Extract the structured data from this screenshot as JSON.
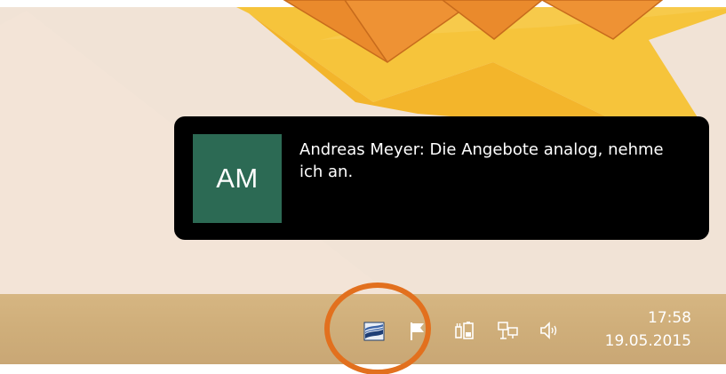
{
  "notification": {
    "avatar_initials": "AM",
    "message": "Andreas Meyer: Die Angebote analog, nehme ich an.",
    "avatar_color": "#2c6a54"
  },
  "taskbar": {
    "tray_icons": [
      "app-notification-icon",
      "action-center-flag-icon",
      "power-battery-icon",
      "network-icon",
      "volume-icon"
    ],
    "clock": {
      "time": "17:58",
      "date": "19.05.2015"
    }
  },
  "annotations": {
    "arrow_color": "#ea8a2c",
    "circle_color": "#e2701e"
  }
}
